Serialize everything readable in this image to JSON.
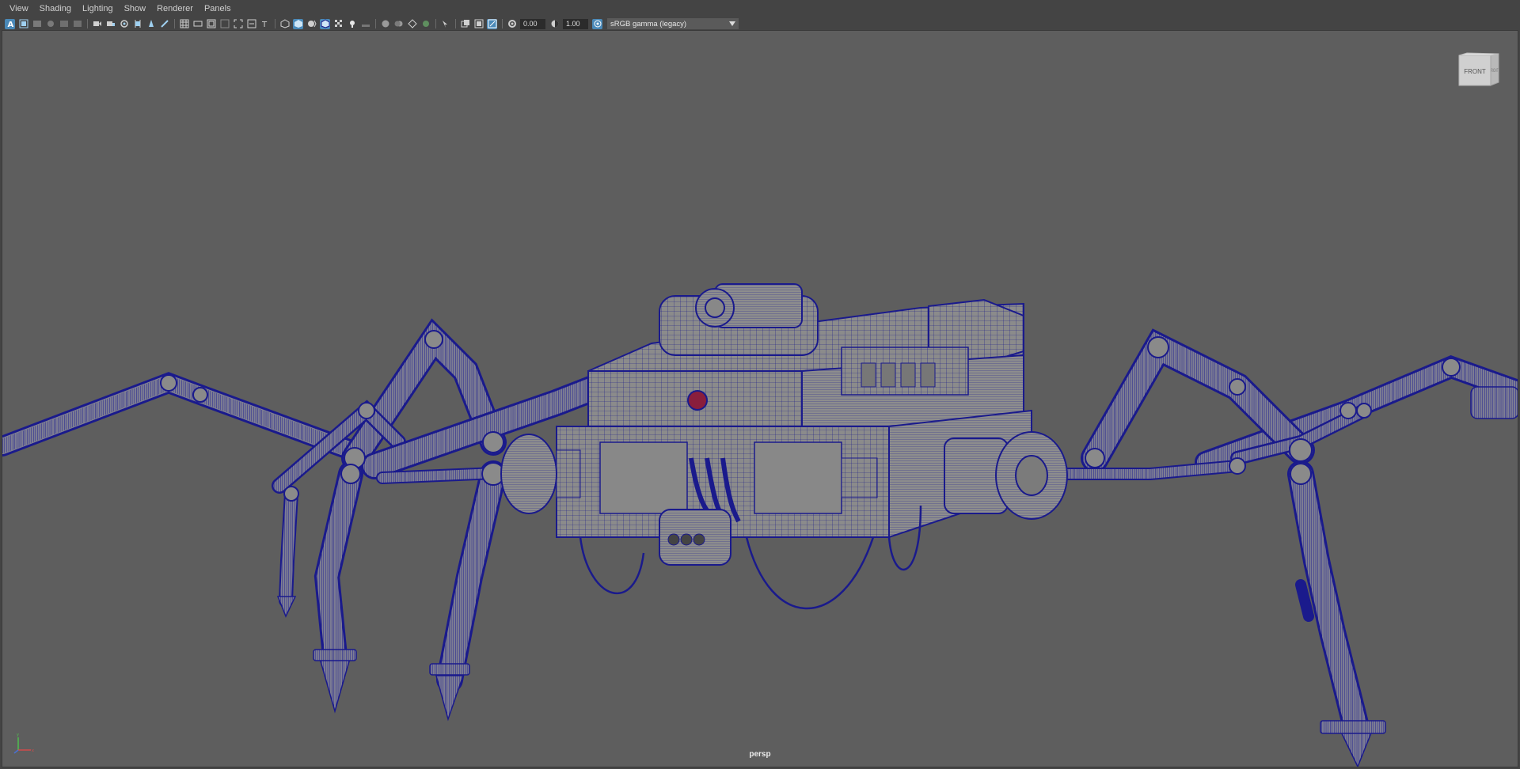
{
  "menu": [
    "View",
    "Shading",
    "Lighting",
    "Show",
    "Renderer",
    "Panels"
  ],
  "toolbar": {
    "exposure_value": "0.00",
    "gamma_value": "1.00",
    "color_space": "sRGB gamma (legacy)"
  },
  "icons": {
    "group1": [
      "select-camera-icon",
      "camera-attributes-icon",
      "bookmark-icon",
      "image-plane-icon",
      "2d-pan-zoom-icon",
      "grease-pencil-icon"
    ],
    "group2": [
      "camera-icon",
      "lock-camera-icon",
      "snapshot-icon",
      "film-gate-icon",
      "resolution-gate-icon",
      "gate-mask-icon",
      "field-chart-icon",
      "safe-action-icon",
      "safe-title-icon"
    ],
    "group3": [
      "wireframe-icon",
      "smooth-shade-icon",
      "default-lighting-icon",
      "wireframe-on-shaded-icon",
      "textured-icon",
      "use-lights-icon",
      "shadows-icon"
    ],
    "group4": [
      "screen-space-ao-icon",
      "motion-blur-icon",
      "anti-alias-icon",
      "depth-of-field-icon"
    ],
    "group5": [
      "isolate-select-icon",
      "xray-icon",
      "xray-joints-icon",
      "xray-active-icon"
    ]
  },
  "viewport": {
    "camera_label": "persp",
    "viewcube_face": "FRONT",
    "viewcube_side": "RIGHT",
    "background": "#5e5e5e",
    "wire_color": "#14148c",
    "mesh_color": "#8a8a8a",
    "accent_color": "#4a89b8"
  }
}
